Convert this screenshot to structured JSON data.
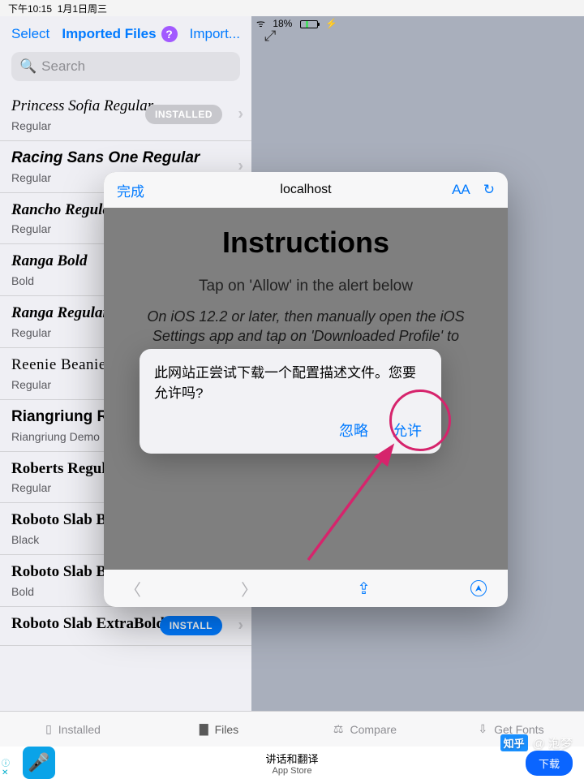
{
  "status": {
    "time": "下午10:15",
    "date": "1月1日周三",
    "battery": "18%"
  },
  "toolbar": {
    "select": "Select",
    "title": "Imported Files",
    "import": "Import..."
  },
  "search": {
    "placeholder": "Search"
  },
  "fonts": [
    {
      "name": "Princess Sofia Regular",
      "style": "Regular",
      "cls": "f-script",
      "pill": "INSTALLED",
      "pillType": "installed"
    },
    {
      "name": "Racing Sans One Regular",
      "style": "Regular",
      "cls": "f-ital-bold"
    },
    {
      "name": "Rancho Regular",
      "style": "Regular",
      "cls": "f-serif-ital"
    },
    {
      "name": "Ranga Bold",
      "style": "Bold",
      "cls": "f-serif-bold"
    },
    {
      "name": "Ranga Regular",
      "style": "Regular",
      "cls": "f-serif-ital"
    },
    {
      "name": "Reenie Beanie Regular",
      "style": "Regular",
      "cls": "f-thin-script"
    },
    {
      "name": "Riangriung Riangriung Demo",
      "style": "Riangriung Demo",
      "cls": "f-demo"
    },
    {
      "name": "Roberts Regular",
      "style": "Regular",
      "cls": "f-brush"
    },
    {
      "name": "Roboto Slab Black",
      "style": "Black",
      "cls": "f-slab"
    },
    {
      "name": "Roboto Slab Bold",
      "style": "Bold",
      "cls": "f-slab",
      "pill": "INSTALL",
      "pillType": "install"
    },
    {
      "name": "Roboto Slab ExtraBold",
      "style": "",
      "cls": "f-slab",
      "pill": "INSTALL",
      "pillType": "install"
    }
  ],
  "sheet": {
    "done": "完成",
    "host": "localhost",
    "aa": "AA",
    "title": "Instructions",
    "line1": "Tap on 'Allow' in the alert below",
    "line2": "On iOS 12.2 or later, then manually open the iOS Settings app and tap on 'Downloaded Profile' to"
  },
  "alert": {
    "msg": "此网站正尝试下载一个配置描述文件。您要允许吗?",
    "ignore": "忽略",
    "allow": "允许"
  },
  "tabs": {
    "installed": "Installed",
    "files": "Files",
    "compare": "Compare",
    "get": "Get Fonts"
  },
  "ad": {
    "title": "讲话和翻译",
    "sub": "App Store",
    "btn": "下载"
  },
  "watermark": {
    "logo": "知乎",
    "user": "@ 泡梦"
  }
}
